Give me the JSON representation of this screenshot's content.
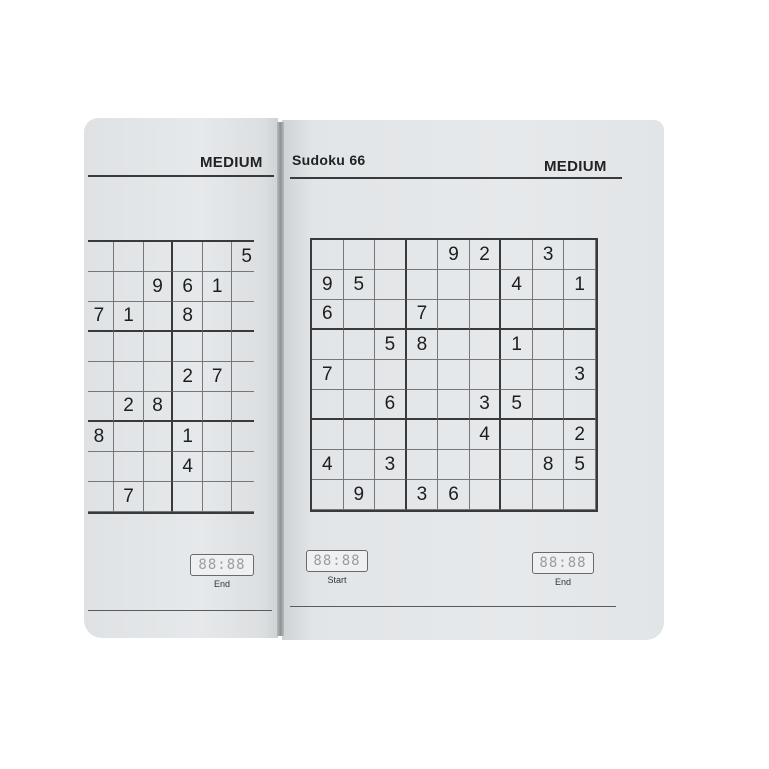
{
  "left_page": {
    "difficulty": "MEDIUM",
    "grid": [
      [
        "",
        "",
        "",
        "",
        "",
        "5"
      ],
      [
        "",
        "",
        "9",
        "6",
        "1",
        ""
      ],
      [
        "7",
        "1",
        "",
        "8",
        "",
        ""
      ],
      [
        "",
        "",
        "",
        "",
        "",
        ""
      ],
      [
        "",
        "",
        "",
        "2",
        "7",
        ""
      ],
      [
        "",
        "2",
        "8",
        "",
        "",
        ""
      ],
      [
        "8",
        "",
        "",
        "1",
        "",
        ""
      ],
      [
        "",
        "",
        "",
        "4",
        "",
        ""
      ],
      [
        "",
        "7",
        "",
        "",
        "",
        ""
      ]
    ],
    "timer_label": "End",
    "timer_display": "88:88"
  },
  "right_page": {
    "title": "Sudoku 66",
    "difficulty": "MEDIUM",
    "grid": [
      [
        "",
        "",
        "",
        "",
        "9",
        "2",
        "",
        "3",
        ""
      ],
      [
        "9",
        "5",
        "",
        "",
        "",
        "",
        "4",
        "",
        "1"
      ],
      [
        "6",
        "",
        "",
        "7",
        "",
        "",
        "",
        "",
        ""
      ],
      [
        "",
        "",
        "5",
        "8",
        "",
        "",
        "1",
        "",
        ""
      ],
      [
        "7",
        "",
        "",
        "",
        "",
        "",
        "",
        "",
        "3"
      ],
      [
        "",
        "",
        "6",
        "",
        "",
        "3",
        "5",
        "",
        ""
      ],
      [
        "",
        "",
        "",
        "",
        "",
        "4",
        "",
        "",
        "2"
      ],
      [
        "4",
        "",
        "3",
        "",
        "",
        "",
        "",
        "8",
        "5"
      ],
      [
        "",
        "9",
        "",
        "3",
        "6",
        "",
        "",
        "",
        ""
      ]
    ],
    "start_label": "Start",
    "end_label": "End",
    "timer_display": "88:88"
  }
}
